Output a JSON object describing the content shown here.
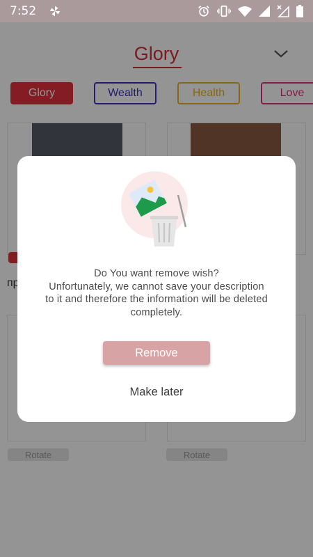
{
  "status_bar": {
    "time": "7:52",
    "icons": [
      "pinwheel-icon",
      "alarm-icon",
      "vibrate-icon",
      "wifi-icon",
      "signal-icon",
      "no-data-signal-icon",
      "battery-icon"
    ]
  },
  "header": {
    "title": "Glory",
    "dropdown_icon": "chevron-down-icon"
  },
  "tabs": [
    {
      "label": "Glory",
      "color": "#e2323d",
      "selected": true
    },
    {
      "label": "Wealth",
      "color": "#3e2fc7",
      "selected": false
    },
    {
      "label": "Health",
      "color": "#e8b21f",
      "selected": false
    },
    {
      "label": "Love",
      "color": "#e0317d",
      "selected": false
    }
  ],
  "cards": {
    "partial_text": "пр",
    "rotate_label_1": "Rotate",
    "rotate_label_2": "Rotate"
  },
  "dialog": {
    "illustration": "delete-image-trash-icon",
    "message_line1": "Do You want remove wish?",
    "message_line2": "Unfortunately, we cannot save your description",
    "message_line3": "to it and therefore the information will be deleted",
    "message_line4": "completely.",
    "primary_button": "Remove",
    "secondary_button": "Make later"
  },
  "colors": {
    "accent_red": "#d32f3a",
    "remove_button": "#d8a3a5"
  }
}
